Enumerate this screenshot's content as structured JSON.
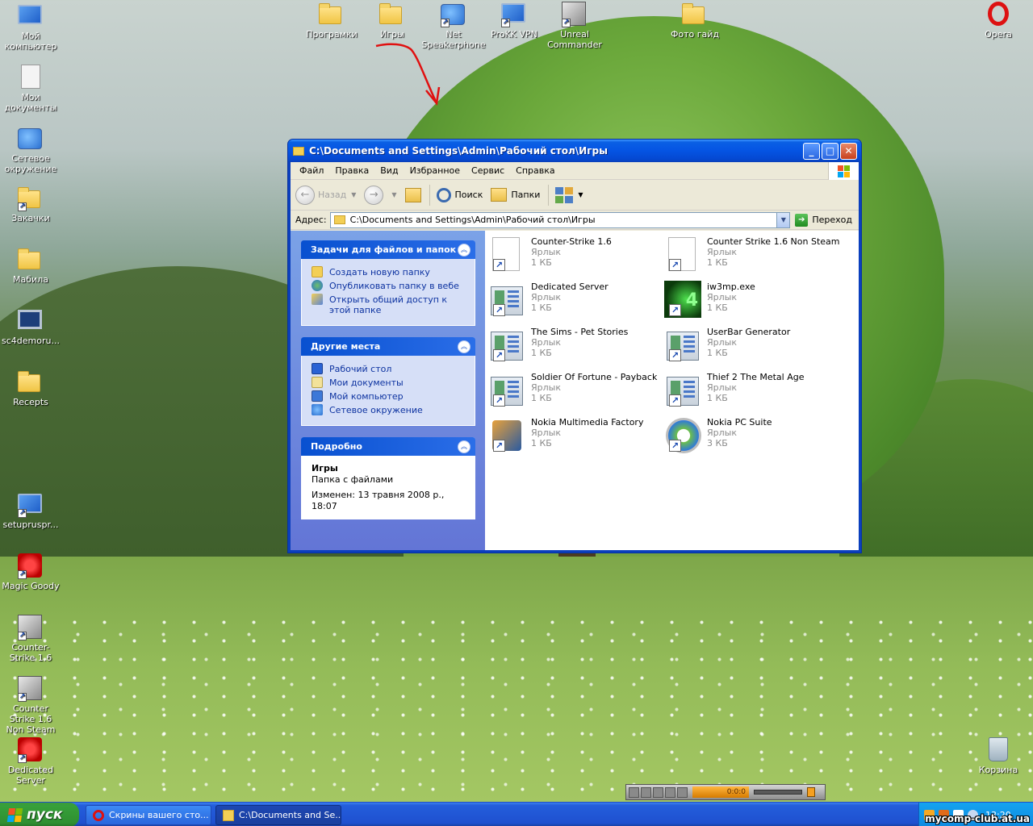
{
  "desktop": {
    "icons_left": [
      {
        "label": "Мой компьютер",
        "icon": "my-computer-icon"
      },
      {
        "label": "Мои документы",
        "icon": "my-documents-icon"
      },
      {
        "label": "Сетевое окружение",
        "icon": "network-places-icon"
      },
      {
        "label": "Закачки",
        "icon": "downloads-folder-icon"
      },
      {
        "label": "Мабила",
        "icon": "folder-icon"
      },
      {
        "label": "sc4demoru...",
        "icon": "monitor-icon"
      },
      {
        "label": "Recepts",
        "icon": "folder-icon"
      },
      {
        "label": "setupruspr...",
        "icon": "setup-icon"
      },
      {
        "label": "Magic Goody",
        "icon": "magic-goody-icon"
      },
      {
        "label": "Counter-Strike 1.6",
        "icon": "counter-strike-icon"
      },
      {
        "label": "Counter Strike 1.6 Non Steam",
        "icon": "counter-strike-icon"
      },
      {
        "label": "Dedicated Server",
        "icon": "dedicated-server-icon"
      }
    ],
    "icons_top": [
      {
        "label": "Програмки",
        "icon": "folder-icon"
      },
      {
        "label": "Игры",
        "icon": "folder-icon"
      },
      {
        "label": "Net Speakerphone",
        "icon": "speakerphone-icon"
      },
      {
        "label": "ProKK VPN",
        "icon": "vpn-icon"
      },
      {
        "label": "Unreal Commander",
        "icon": "unreal-commander-icon"
      },
      {
        "label": "Фото гайд",
        "icon": "folder-icon"
      }
    ],
    "icons_right": [
      {
        "label": "Opera",
        "icon": "opera-icon"
      },
      {
        "label": "Корзина",
        "icon": "recycle-bin-icon"
      }
    ]
  },
  "window": {
    "title": "C:\\Documents and Settings\\Admin\\Рабочий стол\\Игры",
    "menu": [
      "Файл",
      "Правка",
      "Вид",
      "Избранное",
      "Сервис",
      "Справка"
    ],
    "toolbar": {
      "back": "Назад",
      "search": "Поиск",
      "folders": "Папки"
    },
    "address": {
      "label": "Адрес:",
      "value": "C:\\Documents and Settings\\Admin\\Рабочий стол\\Игры",
      "go": "Переход"
    },
    "tasks": {
      "title": "Задачи для файлов и папок",
      "items": [
        "Создать новую папку",
        "Опубликовать папку в вебе",
        "Открыть общий доступ к этой папке"
      ]
    },
    "places": {
      "title": "Другие места",
      "items": [
        "Рабочий стол",
        "Мои документы",
        "Мой компьютер",
        "Сетевое окружение"
      ]
    },
    "details": {
      "title": "Подробно",
      "name": "Игры",
      "type": "Папка с файлами",
      "modified": "Изменен: 13 травня 2008 р., 18:07"
    },
    "files": [
      {
        "name": "Counter-Strike 1.6",
        "type": "Ярлык",
        "size": "1 КБ",
        "icon": "blank"
      },
      {
        "name": "Counter Strike 1.6 Non Steam",
        "type": "Ярлык",
        "size": "1 КБ",
        "icon": "blank"
      },
      {
        "name": "Dedicated Server",
        "type": "Ярлык",
        "size": "1 КБ",
        "icon": "app"
      },
      {
        "name": "iw3mp.exe",
        "type": "Ярлык",
        "size": "1 КБ",
        "icon": "iw"
      },
      {
        "name": "The Sims - Pet Stories",
        "type": "Ярлык",
        "size": "1 КБ",
        "icon": "app"
      },
      {
        "name": "UserBar Generator",
        "type": "Ярлык",
        "size": "1 КБ",
        "icon": "app"
      },
      {
        "name": "Soldier Of Fortune - Payback",
        "type": "Ярлык",
        "size": "1 КБ",
        "icon": "app"
      },
      {
        "name": "Thief 2 The Metal Age",
        "type": "Ярлык",
        "size": "1 КБ",
        "icon": "app"
      },
      {
        "name": "Nokia Multimedia Factory",
        "type": "Ярлык",
        "size": "1 КБ",
        "icon": "nmf"
      },
      {
        "name": "Nokia PC Suite",
        "type": "Ярлык",
        "size": "3 КБ",
        "icon": "pcs"
      }
    ]
  },
  "player": {
    "display": "0:0:0"
  },
  "taskbar": {
    "start": "пуск",
    "buttons": [
      {
        "label": "Скрины вашего сто...",
        "icon": "opera-icon",
        "active": false
      },
      {
        "label": "C:\\Documents and Se...",
        "icon": "folder-icon",
        "active": true
      }
    ],
    "clock": "13:20"
  },
  "watermark": "mycomp-club.at.ua",
  "colors": {
    "xp_blue": "#0554e3",
    "start_green": "#2f8f31",
    "taskpane_blue": "#7ba2e7",
    "link_blue": "#0c32a0"
  }
}
